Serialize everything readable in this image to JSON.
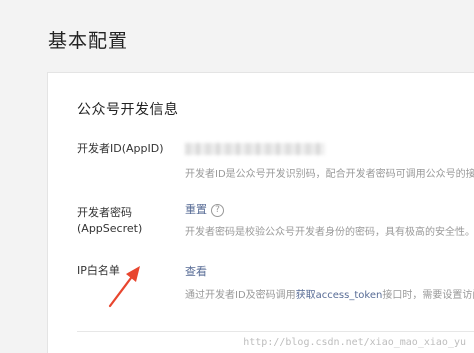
{
  "page": {
    "title": "基本配置"
  },
  "section": {
    "title": "公众号开发信息"
  },
  "rows": [
    {
      "label": "开发者ID(AppID)",
      "desc": "开发者ID是公众号开发识别码，配合开发者密码可调用公众号的接口"
    },
    {
      "label_line1": "开发者密码",
      "label_line2": "(AppSecret)",
      "action": "重置",
      "help_icon": "?",
      "desc": "开发者密码是校验公众号开发者身份的密码，具有极高的安全性。切"
    },
    {
      "label": "IP白名单",
      "action": "查看",
      "desc_prefix": "通过开发者ID及密码调用",
      "desc_link": "获取access_token",
      "desc_suffix": "接口时，需要设置访问来"
    }
  ],
  "watermark": "http://blog.csdn.net/xiao_mao_xiao_yu",
  "colors": {
    "link": "#576b95",
    "arrow": "#e8462f",
    "muted": "#999999"
  }
}
